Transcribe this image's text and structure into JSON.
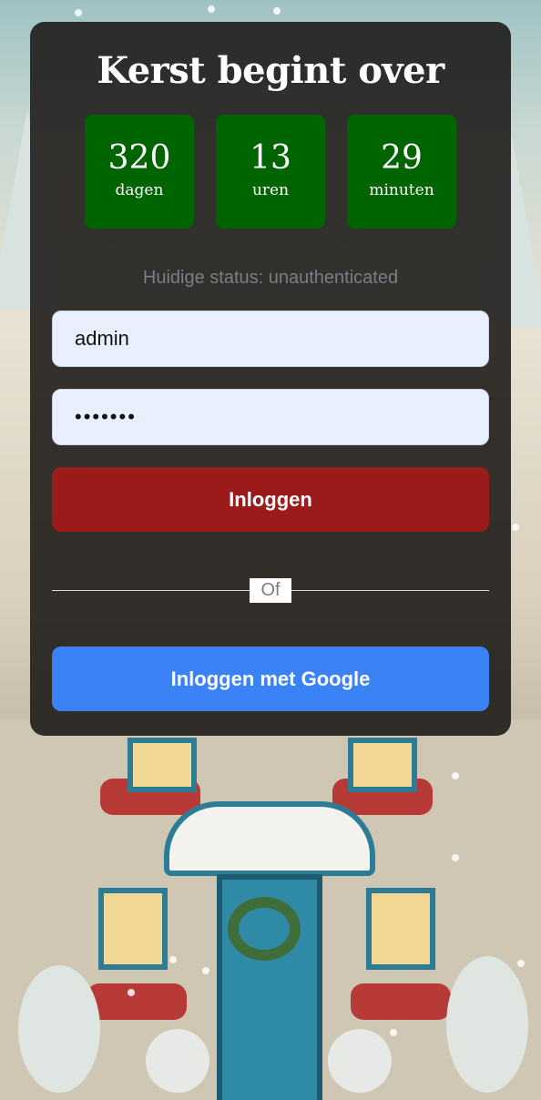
{
  "countdown": {
    "title": "Kerst begint over",
    "days": {
      "value": "320",
      "label": "dagen"
    },
    "hours": {
      "value": "13",
      "label": "uren"
    },
    "minutes": {
      "value": "29",
      "label": "minuten"
    }
  },
  "status_text": "Huidige status: unauthenticated",
  "form": {
    "username_value": "admin",
    "password_value": "1234567",
    "login_label": "Inloggen",
    "divider_text": "Of",
    "google_label": "Inloggen met Google"
  },
  "colors": {
    "countdown_box": "#006400",
    "login_button": "#9b1b1b",
    "google_button": "#3b82f6",
    "input_background": "#e8f0fe"
  },
  "background": {
    "description_icon": "snowy-christmas-house-illustration"
  }
}
